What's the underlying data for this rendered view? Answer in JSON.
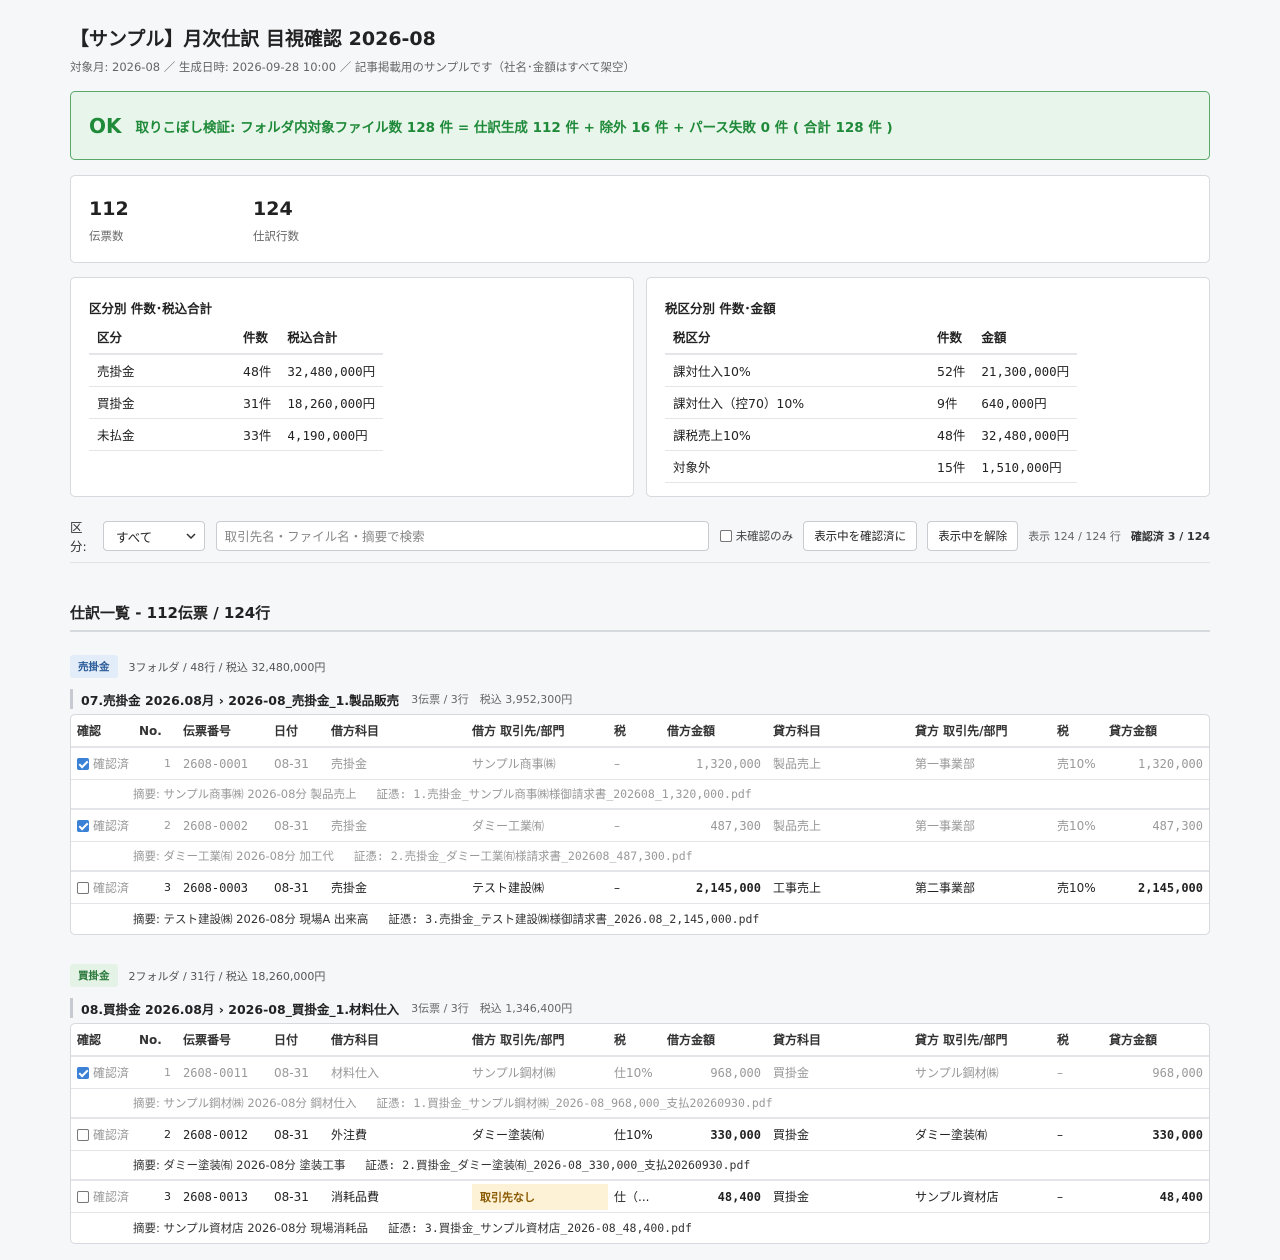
{
  "header": {
    "title": "【サンプル】月次仕訳 目視確認 2026-08",
    "subtitle": "対象月: 2026-08 ／ 生成日時: 2026-09-28 10:00 ／ 記事掲載用のサンプルです（社名･金額はすべて架空）"
  },
  "banner": {
    "status": "OK",
    "text": "取りこぼし検証: フォルダ内対象ファイル数 128 件 = 仕訳生成 112 件 + 除外 16 件 + パース失敗 0 件 ( 合計 128 件 )"
  },
  "stats": [
    {
      "value": "112",
      "label": "伝票数"
    },
    {
      "value": "124",
      "label": "仕訳行数"
    }
  ],
  "category_summary": {
    "title": "区分別 件数･税込合計",
    "headers": [
      "区分",
      "件数",
      "税込合計"
    ],
    "rows": [
      [
        "売掛金",
        "48件",
        "32,480,000円"
      ],
      [
        "買掛金",
        "31件",
        "18,260,000円"
      ],
      [
        "未払金",
        "33件",
        "4,190,000円"
      ]
    ]
  },
  "tax_summary": {
    "title": "税区分別 件数･金額",
    "headers": [
      "税区分",
      "件数",
      "金額"
    ],
    "rows": [
      [
        "課対仕入10%",
        "52件",
        "21,300,000円"
      ],
      [
        "課対仕入（控70）10%",
        "9件",
        "640,000円"
      ],
      [
        "課税売上10%",
        "48件",
        "32,480,000円"
      ],
      [
        "対象外",
        "15件",
        "1,510,000円"
      ]
    ]
  },
  "filter": {
    "label": "区分:",
    "select_value": "すべて",
    "search_placeholder": "取引先名・ファイル名・摘要で検索",
    "unconfirmed_only": "未確認のみ",
    "confirm_visible": "表示中を確認済に",
    "clear_visible": "表示中を解除",
    "display_count": "表示 124 / 124 行",
    "confirmed_count": "確認済 3 / 124"
  },
  "list_title": "仕訳一覧 - 112伝票 / 124行",
  "columns": [
    "確認",
    "No.",
    "伝票番号",
    "日付",
    "借方科目",
    "借方 取引先/部門",
    "税",
    "借方金額",
    "貸方科目",
    "貸方 取引先/部門",
    "税",
    "貸方金額"
  ],
  "confirm_label": "確認済",
  "groups": [
    {
      "badge": "売掛金",
      "meta": "3フォルダ / 48行 / 税込 32,480,000円",
      "folder": "07.売掛金 2026.08月 › 2026-08_売掛金_1.製品販売",
      "folder_meta": "3伝票 / 3行　税込 3,952,300円",
      "entries": [
        {
          "checked": true,
          "no": "1",
          "den": "2608-0001",
          "date": "08-31",
          "dacct": "売掛金",
          "dparty": "サンプル商事㈱",
          "dtax": "–",
          "damt": "1,320,000",
          "cacct": "製品売上",
          "cparty": "第一事業部",
          "ctax": "売10%",
          "camt": "1,320,000",
          "memo": "摘要: サンプル商事㈱ 2026-08分 製品売上",
          "proof": "証憑: 1.売掛金_サンプル商事㈱様御請求書_202608_1,320,000.pdf"
        },
        {
          "checked": true,
          "no": "2",
          "den": "2608-0002",
          "date": "08-31",
          "dacct": "売掛金",
          "dparty": "ダミー工業㈲",
          "dtax": "–",
          "damt": "487,300",
          "cacct": "製品売上",
          "cparty": "第一事業部",
          "ctax": "売10%",
          "camt": "487,300",
          "memo": "摘要: ダミー工業㈲ 2026-08分 加工代",
          "proof": "証憑: 2.売掛金_ダミー工業㈲様請求書_202608_487,300.pdf"
        },
        {
          "checked": false,
          "no": "3",
          "den": "2608-0003",
          "date": "08-31",
          "dacct": "売掛金",
          "dparty": "テスト建設㈱",
          "dtax": "–",
          "damt": "2,145,000",
          "cacct": "工事売上",
          "cparty": "第二事業部",
          "ctax": "売10%",
          "camt": "2,145,000",
          "memo": "摘要: テスト建設㈱ 2026-08分 現場A 出来高",
          "proof": "証憑: 3.売掛金_テスト建設㈱様御請求書_2026.08_2,145,000.pdf"
        }
      ]
    },
    {
      "badge": "買掛金",
      "meta": "2フォルダ / 31行 / 税込 18,260,000円",
      "folder": "08.買掛金 2026.08月 › 2026-08_買掛金_1.材料仕入",
      "folder_meta": "3伝票 / 3行　税込 1,346,400円",
      "entries": [
        {
          "checked": true,
          "no": "1",
          "den": "2608-0011",
          "date": "08-31",
          "dacct": "材料仕入",
          "dparty": "サンプル鋼材㈱",
          "dtax": "仕10%",
          "damt": "968,000",
          "cacct": "買掛金",
          "cparty": "サンプル鋼材㈱",
          "ctax": "–",
          "camt": "968,000",
          "memo": "摘要: サンプル鋼材㈱ 2026-08分 鋼材仕入",
          "proof": "証憑: 1.買掛金_サンプル鋼材㈱_2026-08_968,000_支払20260930.pdf"
        },
        {
          "checked": false,
          "no": "2",
          "den": "2608-0012",
          "date": "08-31",
          "dacct": "外注費",
          "dparty": "ダミー塗装㈲",
          "dtax": "仕10%",
          "damt": "330,000",
          "cacct": "買掛金",
          "cparty": "ダミー塗装㈲",
          "ctax": "–",
          "camt": "330,000",
          "memo": "摘要: ダミー塗装㈲ 2026-08分 塗装工事",
          "proof": "証憑: 2.買掛金_ダミー塗装㈲_2026-08_330,000_支払20260930.pdf"
        },
        {
          "checked": false,
          "no": "3",
          "den": "2608-0013",
          "date": "08-31",
          "dacct": "消耗品費",
          "dparty": "取引先なし",
          "dparty_warn": true,
          "dtax": "仕（...",
          "damt": "48,400",
          "cacct": "買掛金",
          "cparty": "サンプル資材店",
          "ctax": "–",
          "camt": "48,400",
          "memo": "摘要: サンプル資材店 2026-08分 現場消耗品",
          "proof": "証憑: 3.買掛金_サンプル資材店_2026-08_48,400.pdf"
        }
      ]
    }
  ],
  "colors": {
    "ok_green": "#1f8a3a",
    "check_blue": "#3b82d6",
    "warn_bg": "#fdf1d6"
  }
}
